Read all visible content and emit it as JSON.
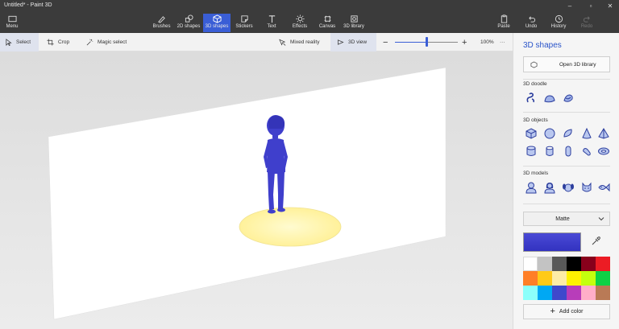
{
  "window": {
    "title": "Untitled* - Paint 3D",
    "minimize": "–",
    "maximize": "▫",
    "close": "✕"
  },
  "ribbon": {
    "menu": "Menu",
    "tools": [
      {
        "label": "Brushes",
        "icon": "brush-icon"
      },
      {
        "label": "2D shapes",
        "icon": "2d-shapes-icon"
      },
      {
        "label": "3D shapes",
        "icon": "3d-shapes-icon",
        "active": true
      },
      {
        "label": "Stickers",
        "icon": "stickers-icon"
      },
      {
        "label": "Text",
        "icon": "text-icon"
      },
      {
        "label": "Effects",
        "icon": "effects-icon"
      },
      {
        "label": "Canvas",
        "icon": "canvas-icon"
      },
      {
        "label": "3D library",
        "icon": "3d-library-icon"
      }
    ],
    "paste": "Paste",
    "undo": "Undo",
    "history": "History",
    "redo": "Redo"
  },
  "toolbar": {
    "select": "Select",
    "crop": "Crop",
    "magic_select": "Magic select",
    "mixed_reality": "Mixed reality",
    "view_3d": "3D view",
    "zoom_out": "−",
    "zoom_in": "+",
    "zoom_level": "100%",
    "zoom_fraction": 0.5,
    "more": "···"
  },
  "panel": {
    "title": "3D shapes",
    "open_library": "Open 3D library",
    "doodle_label": "3D doodle",
    "objects_label": "3D objects",
    "models_label": "3D models",
    "material": "Matte",
    "current_color": "#3f3fcc",
    "add_color": "Add color",
    "palette": [
      "#ffffff",
      "#c3c3c3",
      "#585858",
      "#000000",
      "#88001b",
      "#ec1c24",
      "#ff7f27",
      "#ffca18",
      "#fdeca6",
      "#fff200",
      "#c4ff0e",
      "#0ed145",
      "#8cfffb",
      "#00a8f3",
      "#3f48cc",
      "#b83dba",
      "#ffaec8",
      "#b97a56"
    ]
  },
  "colors": {
    "accent": "#3a5ed6",
    "figure": "#3f3fcc",
    "stage_base": "#fff7b0"
  }
}
